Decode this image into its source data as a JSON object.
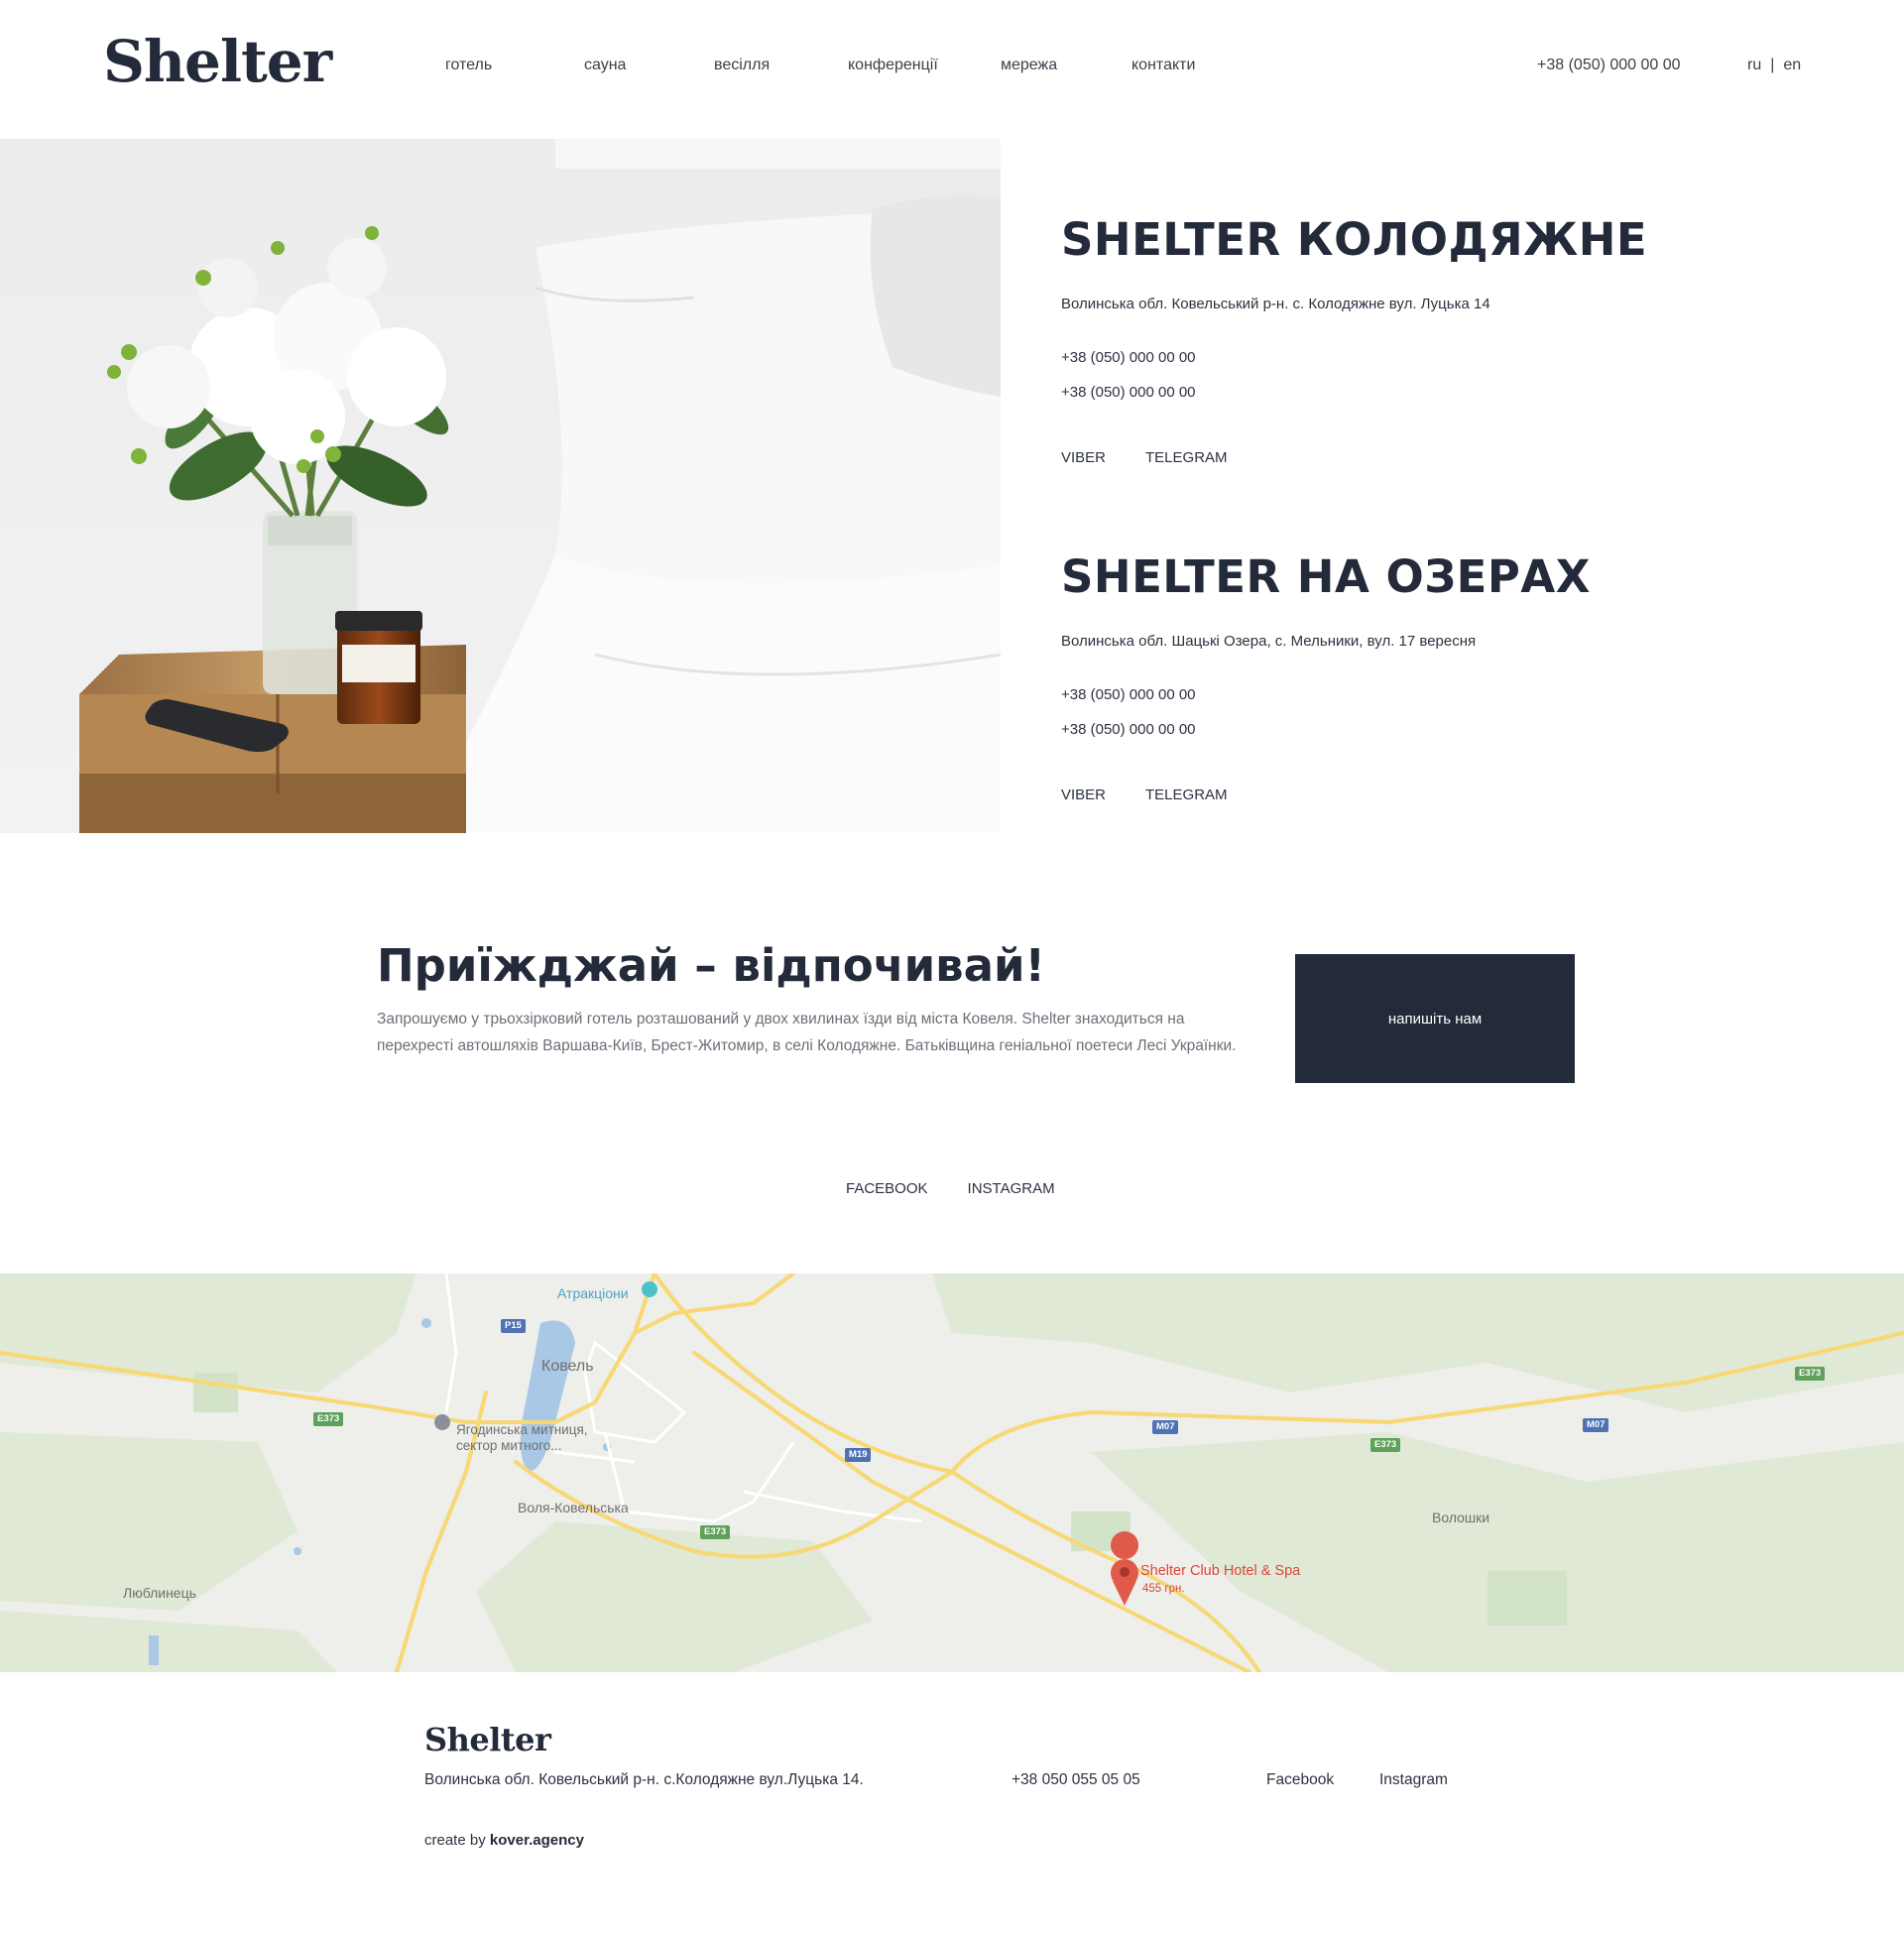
{
  "header": {
    "logo": "Shelter",
    "nav": [
      "готель",
      "сауна",
      "весілля",
      "конференції",
      "мережа",
      "контакти"
    ],
    "phone": "+38 (050) 000 00 00",
    "lang": {
      "ru": "ru",
      "separator": "|",
      "en": "en"
    }
  },
  "hotels": [
    {
      "title": "SHELTER КОЛОДЯЖНЕ",
      "address": "Волинська обл. Ковельський р-н. с. Колодяжне вул. Луцька 14",
      "phones": [
        "+38 (050) 000 00 00",
        "+38 (050) 000 00 00"
      ],
      "messengers": [
        "VIBER",
        "TELEGRAM"
      ]
    },
    {
      "title": "SHELTER НА ОЗЕРАХ",
      "address": "Волинська обл. Шацькі Озера, с. Мельники, вул. 17 вересня",
      "phones": [
        "+38 (050) 000 00 00",
        "+38 (050) 000 00 00"
      ],
      "messengers": [
        "VIBER",
        "TELEGRAM"
      ]
    }
  ],
  "intro": {
    "title": "Приїжджай – відпочивай!",
    "text": "Запрошуємо у трьохзірковий готель розташований у двох хвилинах їзди від міста Ковеля. Shelter знаходиться на перехресті автошляхів Варшава-Київ, Брест-Житомир, в селі Колодяжне. Батьківщина геніальної поетеси Лесі Українки.",
    "button": "напишіть нам"
  },
  "socials": [
    "FACEBOOK",
    "INSTAGRAM"
  ],
  "map": {
    "places": {
      "attractions": "Атракціони",
      "kovel": "Ковель",
      "customs_line1": "Ягодинська митниця,",
      "customs_line2": "сектор митного...",
      "volia": "Воля-Ковельська",
      "volоshky": "Волошки",
      "lyublynets": "Люблинець",
      "hotel_name": "Shelter Club Hotel & Spa",
      "hotel_price": "455 грн."
    },
    "shields": {
      "p15": "P15",
      "e373": "E373",
      "m07": "M07",
      "m19": "M19"
    },
    "colors": {
      "pin": "#e05a49",
      "road": "#f7d873",
      "water": "#a9c8e6"
    }
  },
  "footer": {
    "logo": "Shelter",
    "address": "Волинська обл. Ковельський р-н. с.Колодяжне вул.Луцька 14.",
    "phone": "+38 050 055 05 05",
    "facebook": "Facebook",
    "instagram": "Instagram",
    "credit_prefix": "create by",
    "credit_agency": "kover.agency"
  },
  "accent_color": "#232a3a"
}
